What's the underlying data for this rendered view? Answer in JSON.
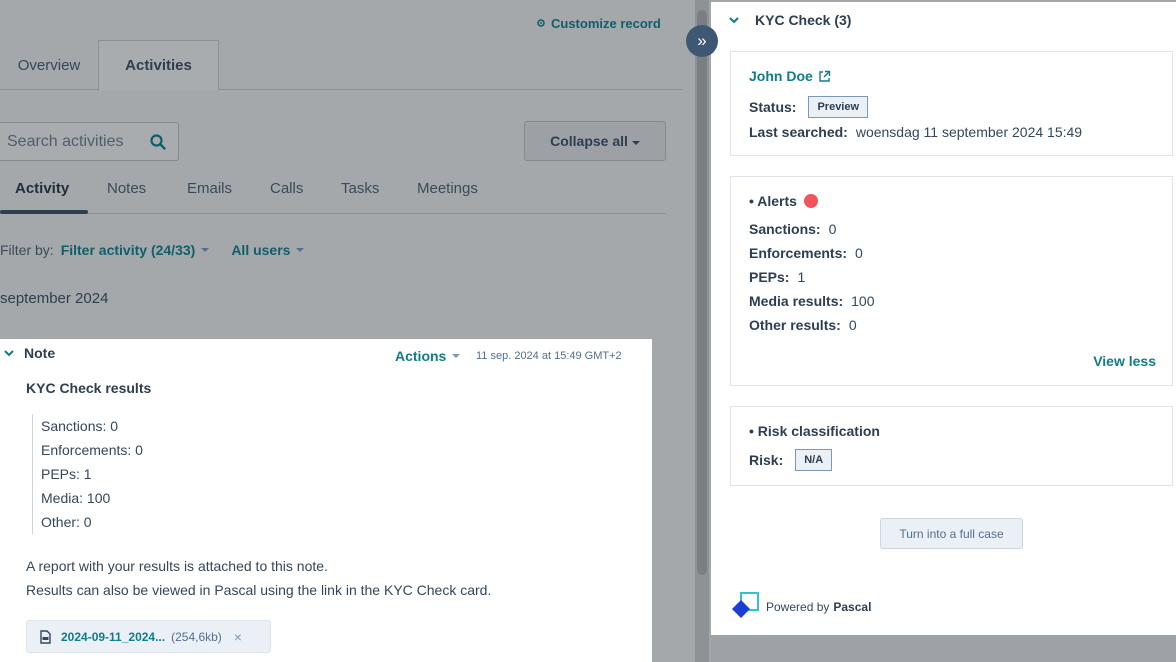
{
  "header": {
    "customize_label": "Customize record"
  },
  "tabs": [
    {
      "label": "Overview"
    },
    {
      "label": "Activities"
    }
  ],
  "search": {
    "placeholder": "Search activities"
  },
  "toolbar": {
    "collapse_label": "Collapse all"
  },
  "subtabs": [
    {
      "label": "Activity"
    },
    {
      "label": "Notes"
    },
    {
      "label": "Emails"
    },
    {
      "label": "Calls"
    },
    {
      "label": "Tasks"
    },
    {
      "label": "Meetings"
    }
  ],
  "filter": {
    "label": "Filter by:",
    "activity": "Filter activity (24/33)",
    "users": "All users"
  },
  "month": "september 2024",
  "note": {
    "type": "Note",
    "actions_label": "Actions",
    "timestamp": "11 sep. 2024 at 15:49 GMT+2",
    "title": "KYC Check results",
    "items": [
      "Sanctions: 0",
      "Enforcements: 0",
      "PEPs: 1",
      "Media: 100",
      "Other: 0"
    ],
    "paragraph1": "A report with your results is attached to this note.",
    "paragraph2": "Results can also be viewed in Pascal using the link in the KYC Check card.",
    "attachment": {
      "name": "2024-09-11_2024...",
      "size": "(254,6kb)",
      "remove": "×"
    }
  },
  "panel": {
    "expand_icon": "»",
    "title": "KYC Check (3)",
    "person": {
      "name": "John Doe",
      "status_label": "Status:",
      "status": "Preview",
      "last_searched_label": "Last searched:",
      "last_searched": "woensdag 11 september 2024 15:49"
    },
    "alerts": {
      "title": "• Alerts",
      "rows": [
        {
          "label": "Sanctions:",
          "value": "0"
        },
        {
          "label": "Enforcements:",
          "value": "0"
        },
        {
          "label": "PEPs:",
          "value": "1"
        },
        {
          "label": "Media results:",
          "value": "100"
        },
        {
          "label": "Other results:",
          "value": "0"
        }
      ],
      "view_less": "View less"
    },
    "risk": {
      "title": "• Risk classification",
      "label": "Risk:",
      "value": "N/A"
    },
    "turn_button": "Turn into a full case",
    "powered_by": "Powered by",
    "brand": "Pascal"
  },
  "colors": {
    "accent": "#0f7c8a",
    "alert": "#f2545b",
    "dark": "#2d3e50"
  }
}
